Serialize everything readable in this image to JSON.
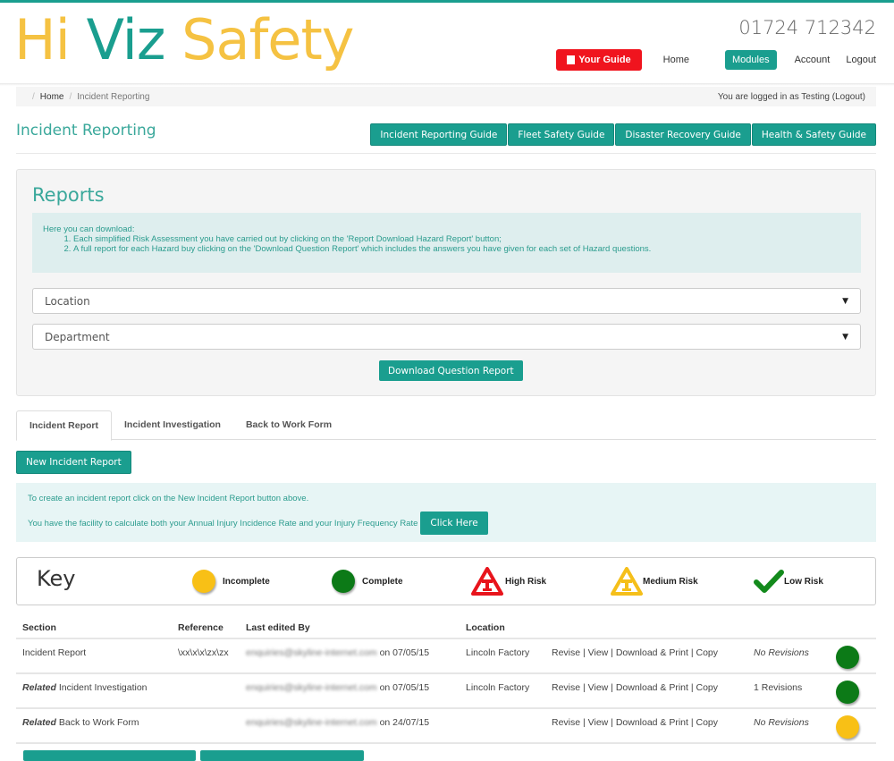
{
  "header": {
    "logo": {
      "part1": "Hi",
      "part2": "Viz",
      "part3": "Safety"
    },
    "phone": "01724 712342",
    "nav": {
      "your_guide": "Your Guide",
      "home": "Home",
      "modules": "Modules",
      "account": "Account",
      "logout": "Logout"
    }
  },
  "breadcrumb": {
    "items": [
      "Home",
      "Incident Reporting"
    ],
    "logged_in": "You are logged in as Testing (Logout)"
  },
  "page": {
    "title": "Incident Reporting",
    "guides": [
      "Incident Reporting Guide",
      "Fleet Safety Guide",
      "Disaster Recovery Guide",
      "Health & Safety Guide"
    ]
  },
  "reports": {
    "title": "Reports",
    "intro": "Here you can download:",
    "list": [
      "Each simplified Risk Assessment you have carried out by clicking on the 'Report Download Hazard Report' button;",
      "A full report for each Hazard buy clicking on the 'Download Question Report' which includes the answers you have given for each set of Hazard questions."
    ],
    "location_select": "Location",
    "department_select": "Department",
    "download_button": "Download Question Report"
  },
  "tabs": [
    {
      "label": "Incident Report",
      "active": true
    },
    {
      "label": "Incident Investigation",
      "active": false
    },
    {
      "label": "Back to Work Form",
      "active": false
    }
  ],
  "new_incident_button": "New Incident Report",
  "alert": {
    "line1": "To create an incident report click on the New Incident Report button above.",
    "line2": "You have the facility to calculate both your Annual Injury Incidence Rate and your Injury Frequency Rate",
    "button": "Click Here"
  },
  "key": {
    "title": "Key",
    "items": [
      {
        "label": "Incomplete",
        "icon": "yellow-circle-icon",
        "color": "#f8c016"
      },
      {
        "label": "Complete",
        "icon": "green-circle-icon",
        "color": "#0c7a17"
      },
      {
        "label": "High Risk",
        "icon": "red-warning-triangle-icon",
        "color": "#e8141c"
      },
      {
        "label": "Medium Risk",
        "icon": "yellow-warning-triangle-icon",
        "color": "#f5bf1a"
      },
      {
        "label": "Low Risk",
        "icon": "green-checkmark-icon",
        "color": "#138a1c"
      }
    ]
  },
  "table": {
    "headers": [
      "Section",
      "Reference",
      "Last edited By",
      "Location",
      "",
      "",
      ""
    ],
    "rows": [
      {
        "prefix": "",
        "section": "Incident Report",
        "reference": "\\xx\\x\\x\\zx\\zx",
        "editor": "enquiries@skyline-internet.com",
        "date": "on 07/05/15",
        "location": "Lincoln Factory",
        "actions": [
          "Revise",
          "View",
          "Download & Print",
          "Copy"
        ],
        "revisions": "No Revisions",
        "revisions_italic": true,
        "status": "complete",
        "status_color": "#0c7a17"
      },
      {
        "prefix": "Related",
        "section": "Incident Investigation",
        "reference": "",
        "editor": "enquiries@skyline-internet.com",
        "date": "on 07/05/15",
        "location": "Lincoln Factory",
        "actions": [
          "Revise",
          "View",
          "Download & Print",
          "Copy"
        ],
        "revisions": "1 Revisions",
        "revisions_italic": false,
        "status": "complete",
        "status_color": "#0c7a17"
      },
      {
        "prefix": "Related",
        "section": "Back to Work Form",
        "reference": "",
        "editor": "enquiries@skyline-internet.com",
        "date": "on 24/07/15",
        "location": "",
        "actions": [
          "Revise",
          "View",
          "Download & Print",
          "Copy"
        ],
        "revisions": "No Revisions",
        "revisions_italic": true,
        "status": "incomplete",
        "status_color": "#f8c016"
      }
    ]
  }
}
